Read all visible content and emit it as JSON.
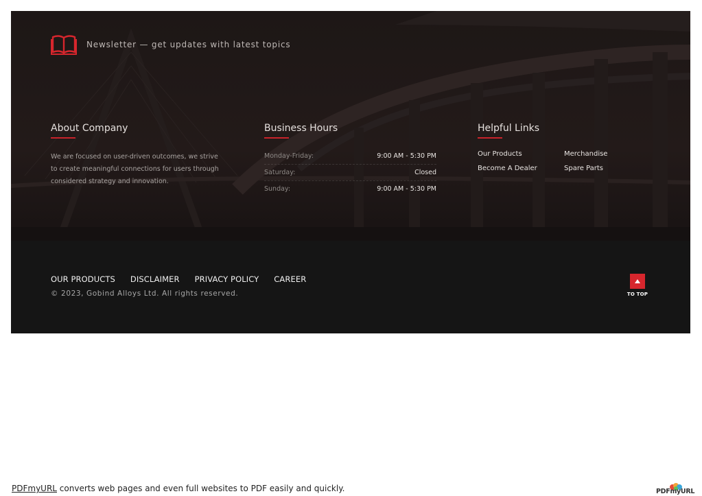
{
  "newsletter": {
    "icon": "book-icon",
    "text": "Newsletter — get updates with latest topics"
  },
  "about": {
    "title": "About Company",
    "text": "We are focused on user-driven outcomes, we strive to create meaningful connections for users through considered strategy and innovation."
  },
  "hours": {
    "title": "Business Hours",
    "rows": [
      {
        "day": "Monday-Friday:",
        "time": "9:00 AM - 5:30 PM"
      },
      {
        "day": "Saturday:",
        "time": "Closed"
      },
      {
        "day": "Sunday:",
        "time": "9:00 AM - 5:30 PM"
      }
    ]
  },
  "links": {
    "title": "Helpful Links",
    "items": [
      "Our Products",
      "Merchandise",
      "Become A Dealer",
      "Spare Parts"
    ]
  },
  "bottom_nav": {
    "items": [
      "OUR PRODUCTS",
      "DISCLAIMER",
      "PRIVACY POLICY",
      "CAREER"
    ]
  },
  "copyright": "© 2023, Gobind Alloys Ltd. All rights reserved.",
  "to_top": {
    "label": "TO TOP",
    "icon": "caret-up-icon"
  },
  "pdf_banner": {
    "link_text": "PDFmyURL",
    "text": " converts web pages and even full websites to PDF easily and quickly.",
    "logo_text": "PDFmyURL"
  },
  "colors": {
    "accent": "#d7262d",
    "footer_dark": "#151515"
  }
}
